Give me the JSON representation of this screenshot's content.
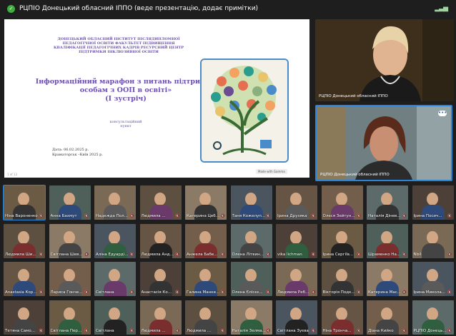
{
  "topbar": {
    "title": "РЦПІО Донецький обласний ІППО (веде презентацію, додає примітки)"
  },
  "slide": {
    "institution": "ДОНЕЦЬКИЙ ОБЛАСНИЙ ІНСТИТУТ ПІСЛЯДИПЛОМНОЇ ПЕДАГОГІЧНОЇ ОСВІТИ ФАКУЛЬТЕТ ПІДВИЩЕННЯ КВАЛІФІКАЦІЇ ПЕДАГОГІЧНИХ КАДРІВ РЕСУРСНИЙ ЦЕНТР ПІДТРИМКИ ІНКЛЮЗИВНОЇ ОСВІТИ",
    "title": "Інформаційний марафон з питань підтримки особам з ООП в освіті»",
    "meeting": "(І зустріч)",
    "subtitle": "консультаційний пункт",
    "date": "Дата: 06.02.2025 р.",
    "place": "Краматорськ –Київ 2025 р.",
    "made_with": "Made with Gamma",
    "page_num": "1 of 13"
  },
  "speakers": [
    {
      "label": "РЦПІО Донецький обласний ІППО"
    },
    {
      "label": "РЦПІО Донецький обласний ІППО"
    }
  ],
  "participants": [
    [
      "Ніна Вароненко",
      "Анна Бахмут",
      "Надежда Пол...",
      "Людмила ...",
      "Катерина Цеб...",
      "Таня Кожелуп...",
      "Ірина Друзяка",
      "Олеся Зейтун...",
      "Наталія Дінев...",
      "Ірина Посич..."
    ],
    [
      "Людмила Ши...",
      "Світлана Шев...",
      "Аліна Едуарді...",
      "Людмила Анд...",
      "Анжела Бабе...",
      "Олена Літвин...",
      "vika lichman",
      "Ірина Сергіїв...",
      "Шраменко На...",
      "Nbil"
    ],
    [
      "Anastasia Кор...",
      "Лариса Гонче...",
      "Світлана",
      "Анастасія Ко...",
      "Галина Манке...",
      "Олена Єлісєє...",
      "Людмила Реб...",
      "Вікторія Подк...",
      "Катерина Мас...",
      "Ірина Микола..."
    ],
    [
      "Тетяна Само...",
      "Світлана Пер...",
      "Світлана",
      "Людмила ...",
      "Людмила ...",
      "Наталія Зелма...",
      "Світлана Зуєва",
      "Ніна Тронча...",
      "Діана Кийко",
      "РЦПІО Донець..."
    ]
  ]
}
